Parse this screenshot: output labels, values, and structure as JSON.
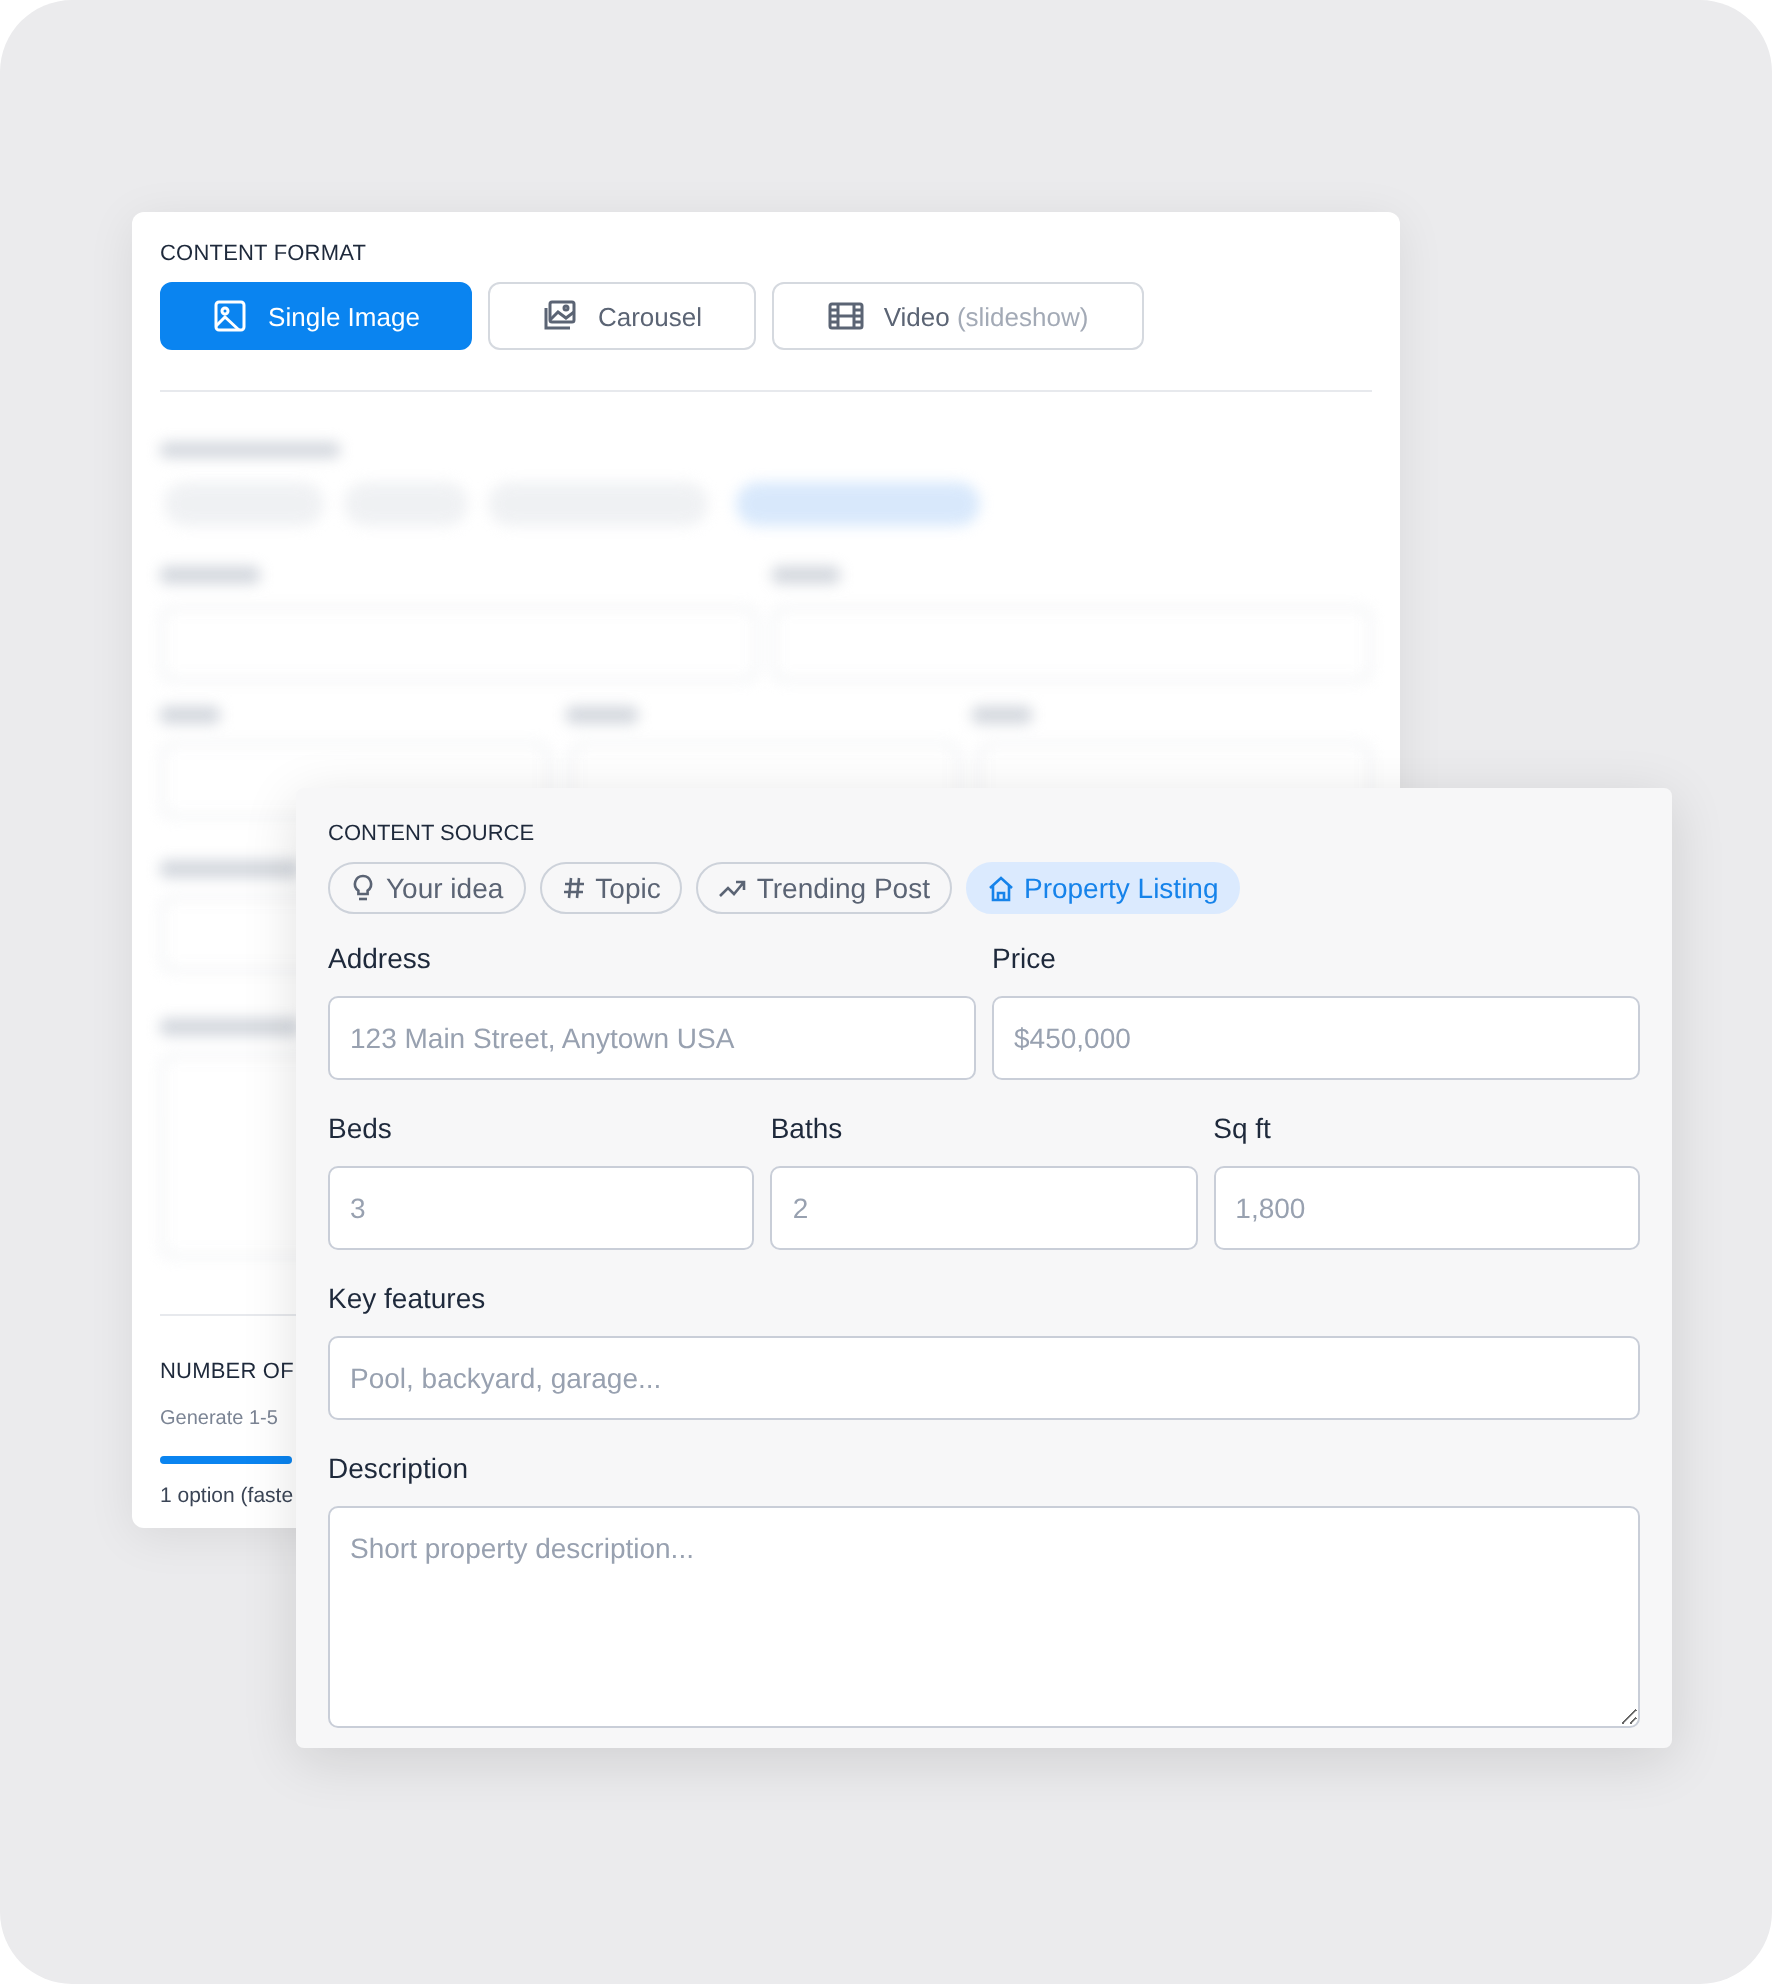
{
  "format_section": {
    "label": "CONTENT FORMAT",
    "options": [
      {
        "kind": "image",
        "label": "Single Image",
        "selected": true
      },
      {
        "kind": "carousel",
        "label": "Carousel",
        "selected": false
      },
      {
        "kind": "video",
        "label": "Video",
        "note": "(slideshow)",
        "selected": false
      }
    ]
  },
  "variations": {
    "label": "NUMBER OF",
    "hint": "Generate 1-5",
    "slider": {
      "level": 1
    },
    "caption": "1 option (faste"
  },
  "source_panel": {
    "label": "CONTENT SOURCE",
    "chips": [
      {
        "kind": "idea",
        "label": "Your idea",
        "selected": false
      },
      {
        "kind": "topic",
        "label": "Topic",
        "selected": false
      },
      {
        "kind": "trending",
        "label": "Trending Post",
        "selected": false
      },
      {
        "kind": "property",
        "label": "Property Listing",
        "selected": true
      }
    ],
    "field_rows": [
      [
        {
          "kind": "text",
          "label": "Address",
          "placeholder": "123 Main Street, Anytown USA"
        },
        {
          "kind": "text",
          "label": "Price",
          "placeholder": "$450,000"
        }
      ],
      [
        {
          "kind": "text",
          "label": "Beds",
          "placeholder": "3"
        },
        {
          "kind": "text",
          "label": "Baths",
          "placeholder": "2"
        },
        {
          "kind": "text",
          "label": "Sq ft",
          "placeholder": "1,800"
        }
      ],
      [
        {
          "kind": "text",
          "label": "Key features",
          "placeholder": "Pool, backyard, garage..."
        }
      ],
      [
        {
          "kind": "textarea",
          "label": "Description",
          "placeholder": "Short property description..."
        }
      ]
    ]
  }
}
